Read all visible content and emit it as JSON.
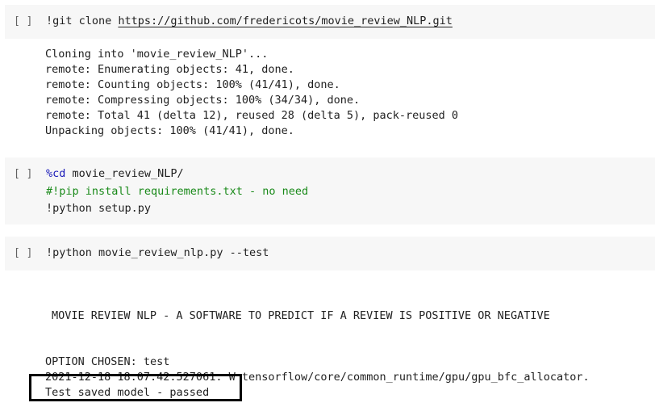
{
  "cells": [
    {
      "run_indicator": "[ ]",
      "code": {
        "prefix": "!git clone ",
        "url": "https://github.com/fredericots/movie_review_NLP.git"
      },
      "output": [
        "Cloning into 'movie_review_NLP'...",
        "remote: Enumerating objects: 41, done.",
        "remote: Counting objects: 100% (41/41), done.",
        "remote: Compressing objects: 100% (34/34), done.",
        "remote: Total 41 (delta 12), reused 28 (delta 5), pack-reused 0",
        "Unpacking objects: 100% (41/41), done."
      ]
    },
    {
      "run_indicator": "[ ]",
      "code_lines": [
        {
          "magic": "%cd",
          "rest": " movie_review_NLP/"
        },
        {
          "comment": "#!pip install requirements.txt - no need"
        },
        {
          "plain": "!python setup.py"
        }
      ]
    },
    {
      "run_indicator": "[ ]",
      "code_line": "!python movie_review_nlp.py --test",
      "output": {
        "banner": "MOVIE REVIEW NLP - A SOFTWARE TO PREDICT IF A REVIEW IS POSITIVE OR NEGATIVE",
        "option": "OPTION CHOSEN: test",
        "log": "2021-12-18 18:07:42.527061: W tensorflow/core/common_runtime/gpu/gpu_bfc_allocator.",
        "result": "Test saved model - passed"
      }
    }
  ]
}
